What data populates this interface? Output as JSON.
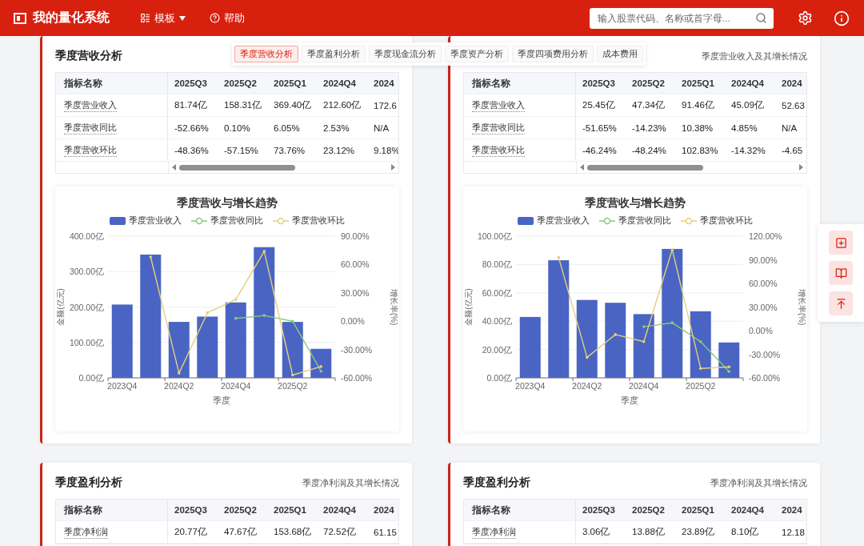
{
  "header": {
    "app_title": "我的量化系统",
    "menu": [
      {
        "kind": "dropdown",
        "label": "模板"
      },
      {
        "kind": "help",
        "label": "帮助"
      }
    ],
    "search": {
      "placeholder": "输入股票代码、名称或首字母..."
    }
  },
  "section_tabs": [
    {
      "label": "季度营收分析",
      "selected": true
    },
    {
      "label": "季度盈利分析",
      "selected": false
    },
    {
      "label": "季度现金流分析",
      "selected": false
    },
    {
      "label": "季度资产分析",
      "selected": false
    },
    {
      "label": "季度四项费用分析",
      "selected": false
    },
    {
      "label": "成本费用",
      "selected": false
    }
  ],
  "cards": [
    {
      "title": "季度营收分析",
      "table": {
        "scrollbar": true,
        "columns": [
          "指标名称",
          "2025Q3",
          "2025Q2",
          "2025Q1",
          "2024Q4",
          "2024"
        ],
        "rows": [
          {
            "cells": [
              "季度营业收入",
              "81.74亿",
              "158.31亿",
              "369.40亿",
              "212.60亿",
              "172.6"
            ]
          },
          {
            "cells": [
              "季度营收同比",
              "-52.66%",
              "0.10%",
              "6.05%",
              "2.53%",
              "N/A"
            ]
          },
          {
            "cells": [
              "季度营收环比",
              "-48.36%",
              "-57.15%",
              "73.76%",
              "23.12%",
              "9.18%"
            ]
          }
        ]
      },
      "chart": {
        "chart_data": {
          "type": "bar",
          "title": "季度营收与增长趋势",
          "xlabel": "季度",
          "ylabel": "金额(亿元)",
          "y2label": "增长率(%)",
          "grid": true,
          "categories": [
            "2023Q4",
            null,
            "2024Q2",
            null,
            "2024Q4",
            null,
            "2025Q2",
            null
          ],
          "ylim": [
            0,
            400
          ],
          "yticks": [
            {
              "value": 0,
              "label": "0.00亿"
            },
            {
              "value": 100,
              "label": "100.00亿"
            },
            {
              "value": 200,
              "label": "200.00亿"
            },
            {
              "value": 300,
              "label": "300.00亿"
            },
            {
              "value": 400,
              "label": "400.00亿"
            }
          ],
          "y2lim": [
            -60,
            90
          ],
          "y2ticks": [
            {
              "value": -60,
              "label": "-60.00%"
            },
            {
              "value": -30,
              "label": "-30.00%"
            },
            {
              "value": 0,
              "label": "0.00%"
            },
            {
              "value": 30,
              "label": "30.00%"
            },
            {
              "value": 60,
              "label": "60.00%"
            },
            {
              "value": 90,
              "label": "90.00%"
            }
          ],
          "series": [
            {
              "name": "季度营业收入",
              "color": "#4a64c4",
              "values": [
                207,
                348,
                158,
                173,
                213,
                369,
                158,
                82
              ]
            },
            {
              "name": "季度营收同比",
              "type": "line",
              "axis": "y2",
              "color": "#8cc97a",
              "values": [
                null,
                null,
                null,
                null,
                3,
                6,
                0,
                -53
              ]
            },
            {
              "name": "季度营收环比",
              "type": "line",
              "axis": "y2",
              "color": "#e3d07a",
              "values": [
                null,
                68,
                -55,
                9,
                23,
                74,
                -57,
                -48
              ]
            }
          ]
        }
      }
    },
    {
      "subtitle": "季度营业收入及其增长情况",
      "table": {
        "scrollbar": true,
        "columns": [
          "指标名称",
          "2025Q3",
          "2025Q2",
          "2025Q1",
          "2024Q4",
          "2024"
        ],
        "rows": [
          {
            "cells": [
              "季度营业收入",
              "25.45亿",
              "47.34亿",
              "91.46亿",
              "45.09亿",
              "52.63"
            ]
          },
          {
            "cells": [
              "季度营收同比",
              "-51.65%",
              "-14.23%",
              "10.38%",
              "4.85%",
              "N/A"
            ]
          },
          {
            "cells": [
              "季度营收环比",
              "-46.24%",
              "-48.24%",
              "102.83%",
              "-14.32%",
              "-4.65"
            ]
          }
        ]
      },
      "chart": {
        "chart_data": {
          "type": "bar",
          "title": "季度营收与增长趋势",
          "xlabel": "季度",
          "ylabel": "金额(亿元)",
          "y2label": "增长率(%)",
          "grid": true,
          "categories": [
            "2023Q4",
            null,
            "2024Q2",
            null,
            "2024Q4",
            null,
            "2025Q2",
            null
          ],
          "ylim": [
            0,
            100
          ],
          "yticks": [
            {
              "value": 0,
              "label": "0.00亿"
            },
            {
              "value": 20,
              "label": "20.00亿"
            },
            {
              "value": 40,
              "label": "40.00亿"
            },
            {
              "value": 60,
              "label": "60.00亿"
            },
            {
              "value": 80,
              "label": "80.00亿"
            },
            {
              "value": 100,
              "label": "100.00亿"
            }
          ],
          "y2lim": [
            -60,
            120
          ],
          "y2ticks": [
            {
              "value": -60,
              "label": "-60.00%"
            },
            {
              "value": -30,
              "label": "-30.00%"
            },
            {
              "value": 0,
              "label": "0.00%"
            },
            {
              "value": 30,
              "label": "30.00%"
            },
            {
              "value": 60,
              "label": "60.00%"
            },
            {
              "value": 90,
              "label": "90.00%"
            },
            {
              "value": 120,
              "label": "120.00%"
            }
          ],
          "series": [
            {
              "name": "季度营业收入",
              "color": "#4a64c4",
              "values": [
                43,
                83,
                55,
                53,
                45,
                91,
                47,
                25
              ]
            },
            {
              "name": "季度营收同比",
              "type": "line",
              "axis": "y2",
              "color": "#8cc97a",
              "values": [
                null,
                null,
                null,
                null,
                5,
                10,
                -14,
                -52
              ]
            },
            {
              "name": "季度营收环比",
              "type": "line",
              "axis": "y2",
              "color": "#e3d07a",
              "values": [
                null,
                93,
                -34,
                -5,
                -14,
                103,
                -48,
                -46
              ]
            }
          ]
        }
      }
    },
    {
      "title": "季度盈利分析",
      "subtitle": "季度净利润及其增长情况",
      "table": {
        "columns": [
          "指标名称",
          "2025Q3",
          "2025Q2",
          "2025Q1",
          "2024Q4",
          "2024"
        ],
        "rows": [
          {
            "cells": [
              "季度净利润",
              "20.77亿",
              "47.67亿",
              "153.68亿",
              "72.52亿",
              "61.15"
            ]
          }
        ]
      }
    },
    {
      "title": "季度盈利分析",
      "subtitle": "季度净利润及其增长情况",
      "table": {
        "columns": [
          "指标名称",
          "2025Q3",
          "2025Q2",
          "2025Q1",
          "2024Q4",
          "2024"
        ],
        "rows": [
          {
            "cells": [
              "季度净利润",
              "3.06亿",
              "13.88亿",
              "23.89亿",
              "8.10亿",
              "12.18"
            ]
          }
        ]
      }
    }
  ]
}
